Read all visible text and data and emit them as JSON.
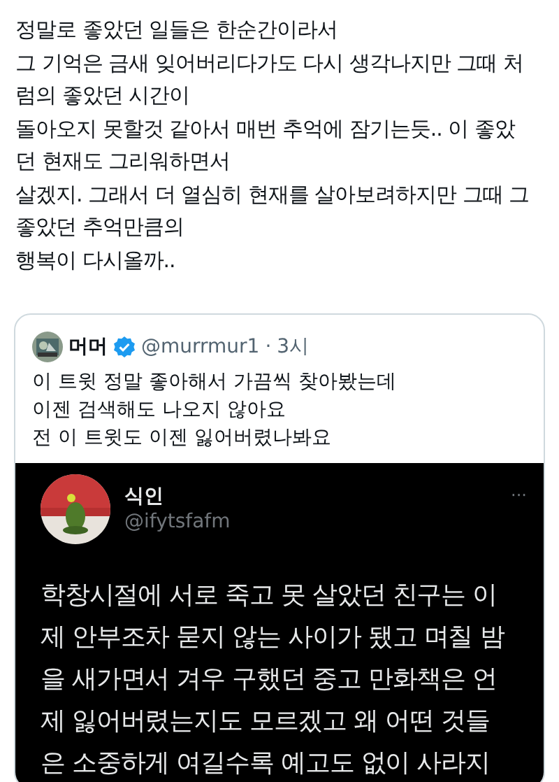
{
  "post": {
    "lines": [
      "정말로 좋았던 일들은 한순간이라서",
      "그 기억은 금새 잊어버리다가도 다시 생각나지만 그때 처",
      "럼의 좋았던 시간이",
      "돌아오지 못할것 같아서 매번 추억에 잠기는듯.. 이 좋았",
      "던 현재도 그리워하면서",
      "살겠지. 그래서 더 열심히 현재를 살아보려하지만 그때 그",
      "좋았던 추억만큼의",
      "행복이 다시올까.."
    ]
  },
  "quote": {
    "name": "머머",
    "verified": true,
    "handle": "@murrmur1",
    "separator": "·",
    "time": "3시",
    "lines": [
      "이 트윗  정말 좋아해서 가끔씩 찾아봤는데",
      "이젠 검색해도 나오지 않아요",
      "전 이 트윗도 이젠 잃어버렸나봐요"
    ],
    "embedded": {
      "name": "식인",
      "handle": "@ifytsfafm",
      "more": "···",
      "lines": [
        "학창시절에 서로 죽고 못 살았던 친구는 이",
        "제 안부조차 묻지 않는 사이가 됐고 며칠 밤",
        "을 새가면서 겨우 구했던 중고 만화책은 언",
        "제 잃어버렸는지도 모르겠고 왜 어떤 것들",
        "은 소중하게 여길수록 예고도 없이 사라지"
      ]
    }
  }
}
